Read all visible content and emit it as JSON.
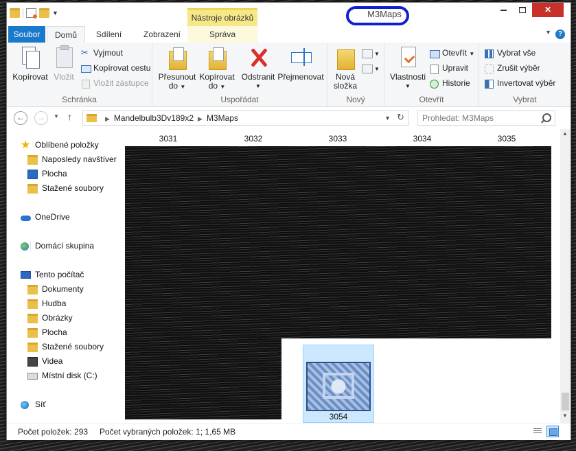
{
  "window": {
    "title": "M3Maps",
    "context_tab_header": "Nástroje obrázků",
    "controls": {
      "minimize": "",
      "maximize": "",
      "close": "✕"
    }
  },
  "ribbon": {
    "tabs": [
      {
        "label": "Soubor"
      },
      {
        "label": "Domů"
      },
      {
        "label": "Sdílení"
      },
      {
        "label": "Zobrazení"
      },
      {
        "label": "Správa"
      }
    ],
    "groups": {
      "clipboard": {
        "label": "Schránka",
        "copy": "Kopírovat",
        "paste": "Vložit",
        "cut": "Vyjmout",
        "copy_path": "Kopírovat cestu",
        "paste_shortcut": "Vložit zástupce"
      },
      "organize": {
        "label": "Uspořádat",
        "move_to": "Přesunout",
        "move_to_sub": "do",
        "copy_to": "Kopírovat",
        "copy_to_sub": "do",
        "delete": "Odstranit",
        "rename": "Přejmenovat"
      },
      "new": {
        "label": "Nový",
        "new_folder": "Nová",
        "new_folder_sub": "složka"
      },
      "open": {
        "label": "Otevřít",
        "properties": "Vlastnosti",
        "open": "Otevřít",
        "edit": "Upravit",
        "history": "Historie"
      },
      "select": {
        "label": "Vybrat",
        "select_all": "Vybrat vše",
        "select_none": "Zrušit výběr",
        "invert": "Invertovat výběr"
      }
    }
  },
  "address": {
    "crumbs": [
      "Mandelbulb3Dv189x2",
      "M3Maps"
    ],
    "search_placeholder": "Prohledat: M3Maps"
  },
  "navpane": {
    "favorites": "Oblíbené položky",
    "recent": "Naposledy navštíver",
    "desktop": "Plocha",
    "downloads": "Stažené soubory",
    "onedrive": "OneDrive",
    "homegroup": "Domácí skupina",
    "this_pc": "Tento počítač",
    "documents": "Dokumenty",
    "music": "Hudba",
    "pictures": "Obrázky",
    "desktop2": "Plocha",
    "downloads2": "Stažené soubory",
    "videos": "Videa",
    "local_disk": "Místní disk (C:)",
    "network": "Síť"
  },
  "content": {
    "column_labels": [
      "3031",
      "3032",
      "3033",
      "3034",
      "3035"
    ],
    "selected_item": {
      "name": "3054"
    }
  },
  "status": {
    "item_count": "Počet položek: 293",
    "selected_info": "Počet vybraných položek: 1; 1,65 MB"
  }
}
